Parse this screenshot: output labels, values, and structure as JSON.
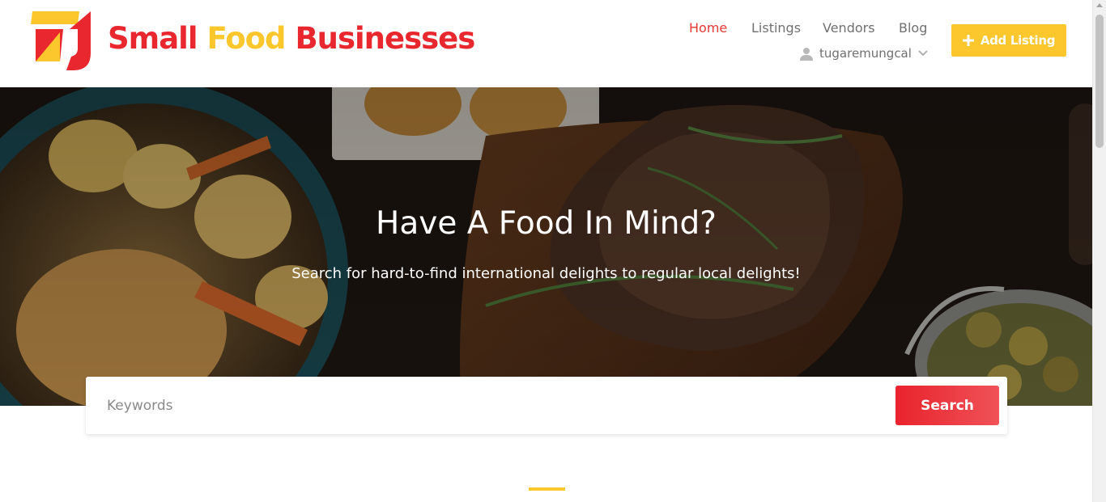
{
  "brand": {
    "name_part1": "Small",
    "name_part2": "Food",
    "name_part3": "Businesses",
    "logo_icon": "small-food-businesses-logo"
  },
  "nav": {
    "items": [
      {
        "label": "Home",
        "active": true
      },
      {
        "label": "Listings",
        "active": false
      },
      {
        "label": "Vendors",
        "active": false
      },
      {
        "label": "Blog",
        "active": false
      }
    ],
    "user": {
      "icon": "user-icon",
      "name": "tugaremungcal",
      "dropdown_icon": "chevron-down-icon"
    },
    "add_listing": {
      "icon": "plus-icon",
      "label": "Add Listing"
    }
  },
  "hero": {
    "title": "Have A Food In Mind?",
    "subtitle": "Search for hard-to-find international delights to regular local delights!"
  },
  "search": {
    "placeholder": "Keywords",
    "value": "",
    "button_label": "Search"
  },
  "colors": {
    "brand_red": "#e8272e",
    "brand_yellow": "#fbc72c",
    "nav_active": "#e53935",
    "nav_text": "#707070"
  }
}
